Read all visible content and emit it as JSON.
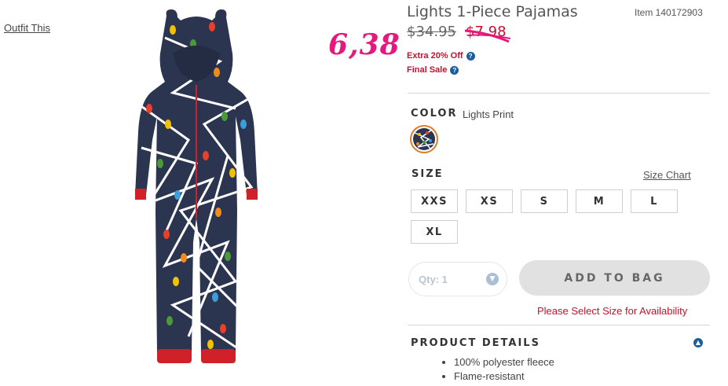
{
  "page": {
    "outfit_link": "Outfit This"
  },
  "annotation": {
    "handwritten_price": "6,38"
  },
  "product": {
    "title": "Lights 1-Piece Pajamas",
    "item_number": "Item 140172903",
    "original_price": "$34.95",
    "sale_price": "$7.98",
    "promos": [
      "Extra 20% Off",
      "Final Sale"
    ]
  },
  "color": {
    "label": "COLOR",
    "value": "Lights Print"
  },
  "size": {
    "label": "SIZE",
    "chart_link": "Size Chart",
    "options": [
      "XXS",
      "XS",
      "S",
      "M",
      "L",
      "XL"
    ]
  },
  "purchase": {
    "qty_label": "Qty: 1",
    "add_to_bag": "ADD TO BAG",
    "availability_message": "Please Select Size for Availability"
  },
  "details": {
    "label": "PRODUCT DETAILS",
    "bullets": [
      "100% polyester fleece",
      "Flame-resistant"
    ]
  },
  "colors": {
    "sale_red": "#c8102e",
    "annotation_pink": "#e5197d",
    "info_blue": "#1b5e9e",
    "swatch_ring": "#e07a24",
    "pajama_navy": "#2c3550",
    "cuff_red": "#d0202a"
  }
}
